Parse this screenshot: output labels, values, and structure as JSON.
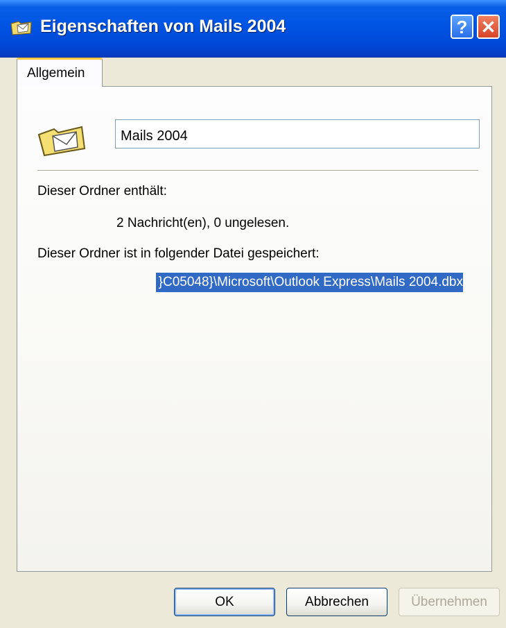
{
  "window": {
    "title": "Eigenschaften von Mails 2004",
    "help_label": "?",
    "close_label": "✕"
  },
  "tabs": [
    {
      "label": "Allgemein",
      "active": true
    }
  ],
  "general": {
    "folder_name": "Mails 2004",
    "contains_label": "Dieser Ordner enthält:",
    "contains_value": "2 Nachricht(en), 0 ungelesen.",
    "file_label": "Dieser Ordner ist in folgender Datei gespeichert:",
    "file_path_visible": "}C05048}\\Microsoft\\Outlook Express\\Mails 2004.dbx"
  },
  "buttons": {
    "ok": "OK",
    "cancel": "Abbrechen",
    "apply": "Übernehmen",
    "apply_enabled": false
  },
  "colors": {
    "titlebar": "#0054e3",
    "selection": "#316ac5",
    "tab_highlight": "#ffc83c",
    "dialog_bg": "#ece9d8"
  },
  "icons": {
    "title": "folder-mail-icon",
    "folder": "folder-mail-icon"
  }
}
